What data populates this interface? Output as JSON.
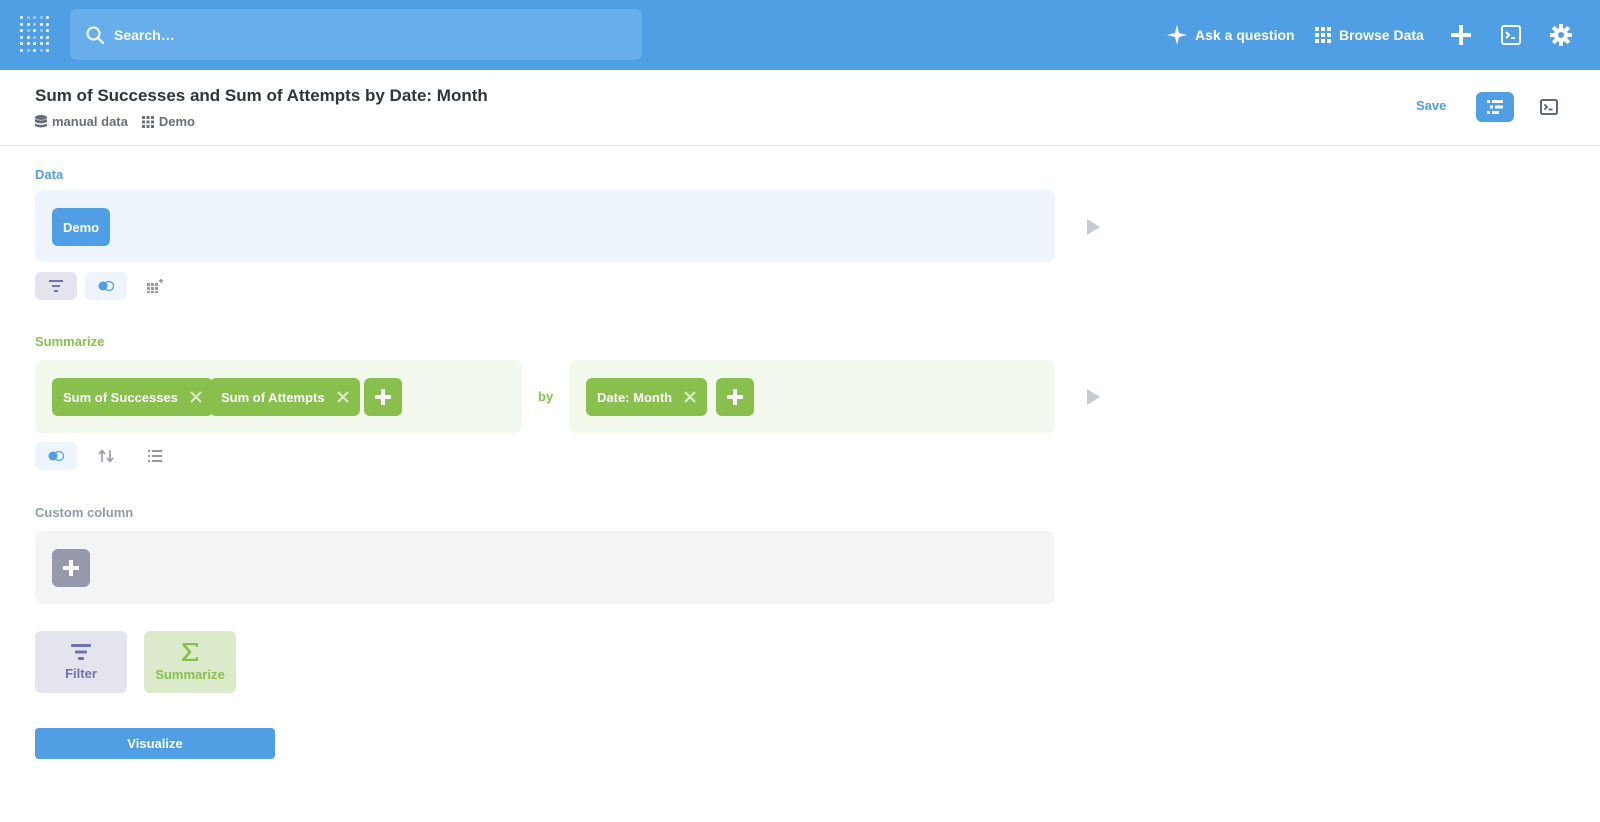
{
  "nav": {
    "search_placeholder": "Search…",
    "ask_question": "Ask a question",
    "browse_data": "Browse Data"
  },
  "header": {
    "title": "Sum of Successes and Sum of Attempts by Date: Month",
    "database": "manual data",
    "table": "Demo",
    "save": "Save"
  },
  "data_section": {
    "label": "Data",
    "source": "Demo"
  },
  "summarize_section": {
    "label": "Summarize",
    "metrics": [
      "Sum of Successes",
      "Sum of Attempts"
    ],
    "by": "by",
    "breakouts": [
      "Date: Month"
    ]
  },
  "custom_column_section": {
    "label": "Custom column"
  },
  "steps": {
    "filter": "Filter",
    "summarize": "Summarize"
  },
  "visualize": "Visualize",
  "colors": {
    "brand": "#509ee3",
    "summarize": "#88bf4d",
    "filter": "#7172ad",
    "neutral": "#949aab"
  }
}
